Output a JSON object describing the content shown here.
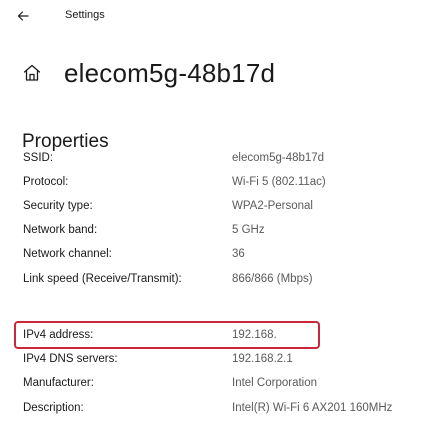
{
  "window": {
    "title": "Settings"
  },
  "header": {
    "title": "elecom5g-48b17d"
  },
  "properties": {
    "title": "Properties",
    "rows": [
      {
        "label": "SSID:",
        "value": "elecom5g-48b17d"
      },
      {
        "label": "Protocol:",
        "value": "Wi-Fi 5 (802.11ac)"
      },
      {
        "label": "Security type:",
        "value": "WPA2-Personal"
      },
      {
        "label": "Network band:",
        "value": "5 GHz"
      },
      {
        "label": "Network channel:",
        "value": "36"
      },
      {
        "label": "Link speed (Receive/Transmit):",
        "value": "866/866 (Mbps)"
      },
      {
        "label": "IPv4 address:",
        "value": "192.168."
      },
      {
        "label": "IPv4 DNS servers:",
        "value": "192.168.2.1"
      },
      {
        "label": "Manufacturer:",
        "value": "Intel Corporation"
      },
      {
        "label": "Description:",
        "value": "Intel(R) Wi-Fi 6 AX201 160MHz"
      }
    ]
  },
  "colors": {
    "highlight": "#c8283a",
    "value_text": "#5a5a5a"
  },
  "icons": {
    "back": "back-arrow-icon",
    "home": "home-icon"
  }
}
